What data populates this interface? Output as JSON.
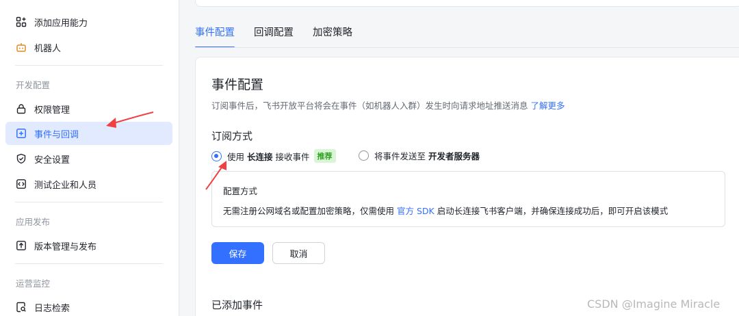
{
  "sidebar": {
    "items": [
      {
        "label": "添加应用能力",
        "icon": "grid-plus-icon"
      },
      {
        "label": "机器人",
        "icon": "robot-icon"
      },
      {
        "label": "权限管理",
        "icon": "lock-icon"
      },
      {
        "label": "事件与回调",
        "icon": "event-box-icon",
        "active": true
      },
      {
        "label": "安全设置",
        "icon": "shield-check-icon"
      },
      {
        "label": "测试企业和人员",
        "icon": "code-box-icon"
      },
      {
        "label": "版本管理与发布",
        "icon": "upload-box-icon"
      },
      {
        "label": "日志检索",
        "icon": "log-search-icon"
      }
    ],
    "groups": {
      "dev": "开发配置",
      "release": "应用发布",
      "ops": "运营监控"
    }
  },
  "tabs": [
    {
      "label": "事件配置",
      "active": true
    },
    {
      "label": "回调配置"
    },
    {
      "label": "加密策略"
    }
  ],
  "main": {
    "title": "事件配置",
    "description": "订阅事件后，飞书开放平台将会在事件（如机器人入群）发生时向请求地址推送消息",
    "learn_more": "了解更多",
    "subscribe_title": "订阅方式",
    "option1": {
      "prefix": "使用",
      "bold": "长连接",
      "suffix": "接收事件",
      "tag": "推荐",
      "selected": true
    },
    "option2": {
      "prefix": "将事件发送至",
      "bold": "开发者服务器",
      "selected": false
    },
    "config_box": {
      "title": "配置方式",
      "text_before": "无需注册公网域名或配置加密策略，仅需使用",
      "link": "官方 SDK",
      "text_after": "启动长连接飞书客户端，并确保连接成功后，即可开启该模式"
    },
    "save_label": "保存",
    "cancel_label": "取消",
    "added_events_title": "已添加事件"
  },
  "watermark": "CSDN @Imagine Miracle",
  "colors": {
    "accent": "#3370ff",
    "active_bg": "#e1eaff",
    "tag_bg": "#d9f5d6",
    "tag_text": "#2ea121",
    "annotation_arrow": "#f04142"
  }
}
